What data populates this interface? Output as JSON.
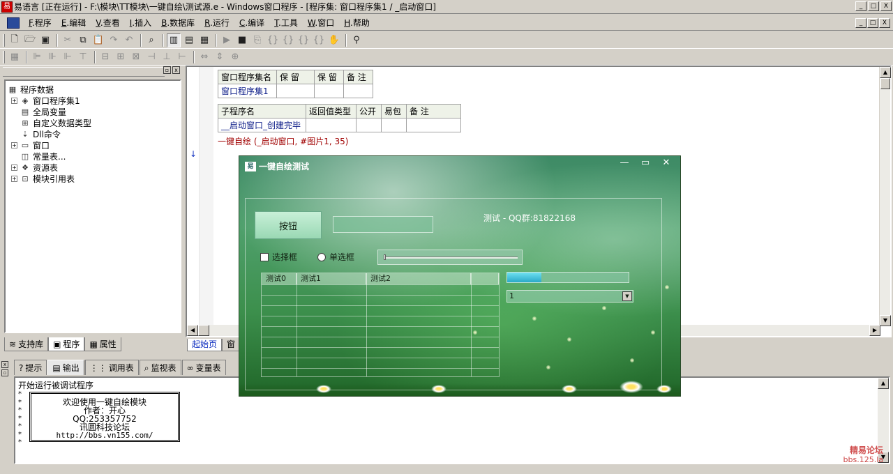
{
  "window": {
    "title": "易语言 [正在运行] - F:\\模块\\TT模块\\一键自绘\\测试源.e - Windows窗口程序 - [程序集: 窗口程序集1 / _启动窗口]",
    "btn_min": "_",
    "btn_max": "□",
    "btn_close": "X"
  },
  "menu": [
    {
      "acc": "F",
      "label": ".程序"
    },
    {
      "acc": "E",
      "label": ".编辑"
    },
    {
      "acc": "V",
      "label": ".查看"
    },
    {
      "acc": "I",
      "label": ".插入"
    },
    {
      "acc": "B",
      "label": ".数据库"
    },
    {
      "acc": "R",
      "label": ".运行"
    },
    {
      "acc": "C",
      "label": ".编译"
    },
    {
      "acc": "T",
      "label": ".工具"
    },
    {
      "acc": "W",
      "label": ".窗口"
    },
    {
      "acc": "H",
      "label": ".帮助"
    }
  ],
  "tree": {
    "root": "程序数据",
    "items": [
      {
        "label": "窗口程序集1",
        "expand": "+",
        "icon": "◈"
      },
      {
        "label": "全局变量",
        "expand": "",
        "icon": "▤"
      },
      {
        "label": "自定义数据类型",
        "expand": "",
        "icon": "⊞"
      },
      {
        "label": "Dll命令",
        "expand": "",
        "icon": "⇣"
      },
      {
        "label": "窗口",
        "expand": "+",
        "icon": "▭"
      },
      {
        "label": "常量表...",
        "expand": "",
        "icon": "◫"
      },
      {
        "label": "资源表",
        "expand": "+",
        "icon": "❖"
      },
      {
        "label": "模块引用表",
        "expand": "+",
        "icon": "⊡"
      }
    ]
  },
  "left_tabs": [
    {
      "label": "支持库",
      "icon": "≋"
    },
    {
      "label": "程序",
      "icon": "▣"
    },
    {
      "label": "属性",
      "icon": "▦"
    }
  ],
  "editor": {
    "assembly_table": {
      "headers": [
        "窗口程序集名",
        "保 留",
        "保 留",
        "备 注"
      ],
      "rows": [
        [
          "窗口程序集1",
          "",
          "",
          ""
        ]
      ]
    },
    "sub_table": {
      "headers": [
        "子程序名",
        "返回值类型",
        "公开",
        "易包",
        "备 注"
      ],
      "rows": [
        [
          "__启动窗口_创建完毕",
          "",
          "",
          "",
          ""
        ]
      ]
    },
    "code_line": {
      "fn": "一键自绘",
      "args": " (_启动窗口, #图片1, 35)"
    },
    "tabs": [
      "起始页",
      "窗"
    ]
  },
  "bottom_tabs": [
    {
      "label": "提示",
      "icon": "?"
    },
    {
      "label": "输出",
      "icon": "▤"
    },
    {
      "label": "调用表",
      "icon": "⋮⋮"
    },
    {
      "label": "监视表",
      "icon": "⌕"
    },
    {
      "label": "变量表",
      "icon": "∞"
    }
  ],
  "output": {
    "line1": "开始运行被调试程序",
    "box_lines": [
      "欢迎使用一键自绘模块",
      "作者：开心",
      "QQ:253357752",
      "讯圆科技论坛",
      "http://bbs.vn155.com/"
    ]
  },
  "watermark": {
    "line1": "精易论坛",
    "line2": "bbs.125.la"
  },
  "dialog": {
    "title": "一键自绘测试",
    "icon_text": "易",
    "button_label": "按钮",
    "top_label": "测试 - QQ群:81822168",
    "checkbox_label": "选择框",
    "radio_label": "单选框",
    "grid_headers": [
      "测试0",
      "测试1",
      "测试2",
      ""
    ],
    "combo_value": "1",
    "progress": 0.28,
    "slider": 0.0
  }
}
